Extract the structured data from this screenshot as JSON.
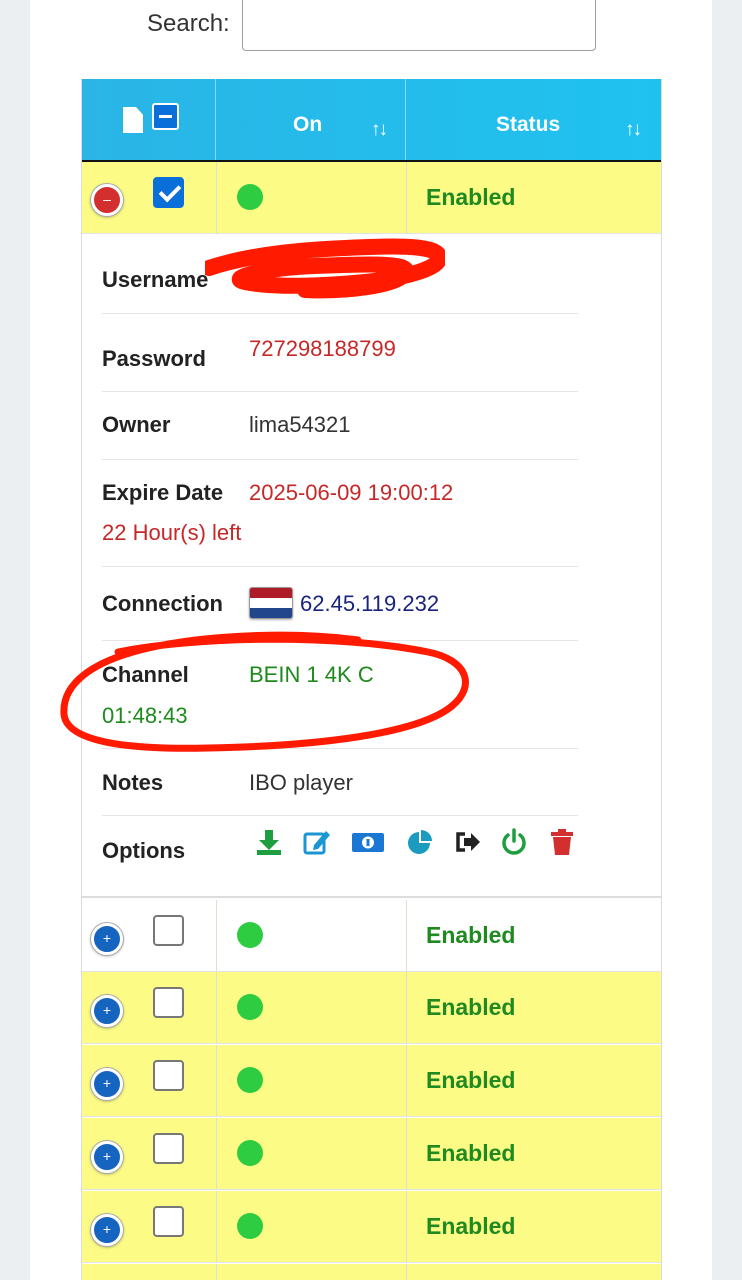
{
  "search": {
    "label": "Search:",
    "value": ""
  },
  "table": {
    "columns": [
      {
        "label": "On",
        "sort_icon": "sort-icon"
      },
      {
        "label": "Status",
        "sort_icon": "sort-icon"
      }
    ]
  },
  "expanded_row": {
    "status": "Enabled",
    "checked": true,
    "online": true
  },
  "details": {
    "username": {
      "label": "Username",
      "value": ""
    },
    "password": {
      "label": "Password",
      "value": "727298188799"
    },
    "owner": {
      "label": "Owner",
      "value": "lima54321"
    },
    "expire": {
      "label": "Expire Date",
      "value": "2025-06-09 19:00:12",
      "remaining": "22 Hour(s) left"
    },
    "connection": {
      "label": "Connection",
      "flag": "netherlands-flag",
      "ip": "62.45.119.232"
    },
    "channel": {
      "label": "Channel",
      "value": "BEIN 1 4K C",
      "duration": "01:48:43"
    },
    "notes": {
      "label": "Notes",
      "value": "IBO player"
    },
    "options": {
      "label": "Options",
      "icons": [
        "download-icon",
        "edit-icon",
        "money-icon",
        "pie-chart-icon",
        "sign-out-icon",
        "power-icon",
        "trash-icon"
      ]
    }
  },
  "rows": [
    {
      "status": "Enabled",
      "checked": false,
      "online": true
    },
    {
      "status": "Enabled",
      "checked": false,
      "online": true
    },
    {
      "status": "Enabled",
      "checked": false,
      "online": true
    },
    {
      "status": "Enabled",
      "checked": false,
      "online": true
    },
    {
      "status": "Enabled",
      "checked": false,
      "online": true
    }
  ],
  "colors": {
    "header": "#1fc2ef",
    "row_highlight": "#fbfb86",
    "status_green": "#1f8a1f",
    "online_dot": "#2ecc40",
    "annotation_red": "#ff1a00"
  }
}
